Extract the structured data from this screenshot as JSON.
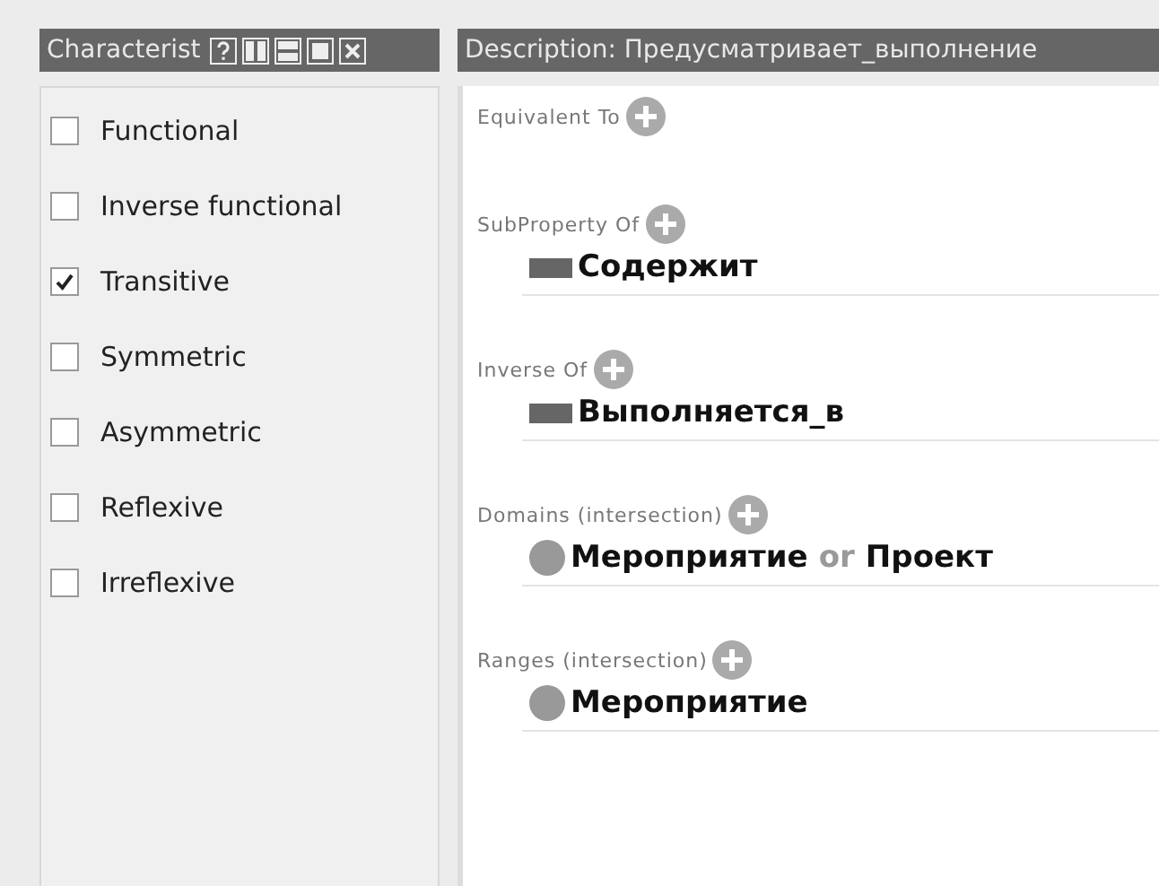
{
  "characteristics_panel": {
    "title": "Characterist",
    "items": [
      {
        "label": "Functional",
        "checked": false
      },
      {
        "label": "Inverse functional",
        "checked": false
      },
      {
        "label": "Transitive",
        "checked": true
      },
      {
        "label": "Symmetric",
        "checked": false
      },
      {
        "label": "Asymmetric",
        "checked": false
      },
      {
        "label": "Reflexive",
        "checked": false
      },
      {
        "label": "Irreflexive",
        "checked": false
      }
    ]
  },
  "description_panel": {
    "title": "Description: Предусматривает_выполнение",
    "sections": [
      {
        "label": "Equivalent To"
      },
      {
        "label": "SubProperty Of",
        "entries": [
          {
            "kind": "property",
            "terms": [
              "Содержит"
            ]
          }
        ]
      },
      {
        "label": "Inverse Of",
        "entries": [
          {
            "kind": "property",
            "terms": [
              "Выполняется_в"
            ]
          }
        ]
      },
      {
        "label": "Domains (intersection)",
        "entries": [
          {
            "kind": "class",
            "terms": [
              "Мероприятие",
              "Проект"
            ],
            "connector": "or"
          }
        ]
      },
      {
        "label": "Ranges (intersection)",
        "entries": [
          {
            "kind": "class",
            "terms": [
              "Мероприятие"
            ]
          }
        ]
      }
    ]
  }
}
